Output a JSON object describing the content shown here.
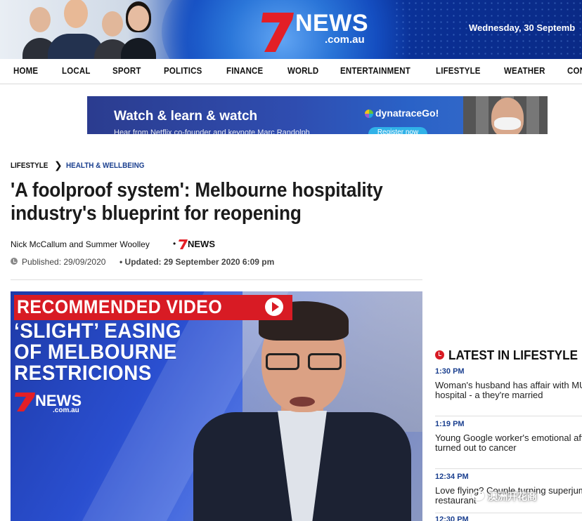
{
  "header": {
    "logo_text": "NEWS",
    "logo_sub": ".com.au",
    "date": "Wednesday, 30 Septemb"
  },
  "nav": {
    "items": [
      {
        "label": "HOME"
      },
      {
        "label": "LOCAL"
      },
      {
        "label": "SPORT"
      },
      {
        "label": "POLITICS"
      },
      {
        "label": "FINANCE"
      },
      {
        "label": "WORLD"
      },
      {
        "label": "ENTERTAINMENT"
      },
      {
        "label": "LIFESTYLE"
      },
      {
        "label": "WEATHER"
      },
      {
        "label": "CON"
      }
    ]
  },
  "ad": {
    "headline": "Watch & learn & watch",
    "subline": "Hear from Netflix co-founder and keynote Marc Randolph",
    "brand": "dynatraceGo!",
    "cta": "Register now"
  },
  "article": {
    "breadcrumb": [
      "LIFESTYLE",
      "HEALTH & WELLBEING"
    ],
    "breadcrumb_separator": "❯",
    "headline": "'A foolproof system': Melbourne hospitality industry's blueprint for reopening",
    "authors": "Nick McCallum and Summer Woolley",
    "byline_separator": "•",
    "byline_brand": "NEWS",
    "published": "Published: 29/09/2020",
    "updated": "• Updated: 29 September 2020 6:09 pm"
  },
  "video": {
    "badge": "RECOMMENDED VIDEO",
    "caption": [
      "‘SLIGHT’ EASING",
      "OF MELBOURNE",
      "RESTRICIONS"
    ],
    "logo_text": "NEWS",
    "logo_sub": ".com.au"
  },
  "latest": {
    "title": "LATEST IN LIFESTYLE",
    "items": [
      {
        "time": "1:30 PM",
        "text": "Woman's husband has affair with MUM while she's in hospital - a they're married"
      },
      {
        "time": "1:19 PM",
        "text": "Young Google worker's emotional after 'broken arm' turned out to cancer"
      },
      {
        "time": "12:34 PM",
        "text": "Love flying? Couple turning superjumbo plane into a restaurant"
      },
      {
        "time": "12:30 PM",
        "text": ""
      }
    ]
  },
  "watermark": "澳洲开花商",
  "colors": {
    "brand_red": "#d81b24",
    "link_blue": "#1a3f8f",
    "header_blue": "#0c3aa8"
  }
}
